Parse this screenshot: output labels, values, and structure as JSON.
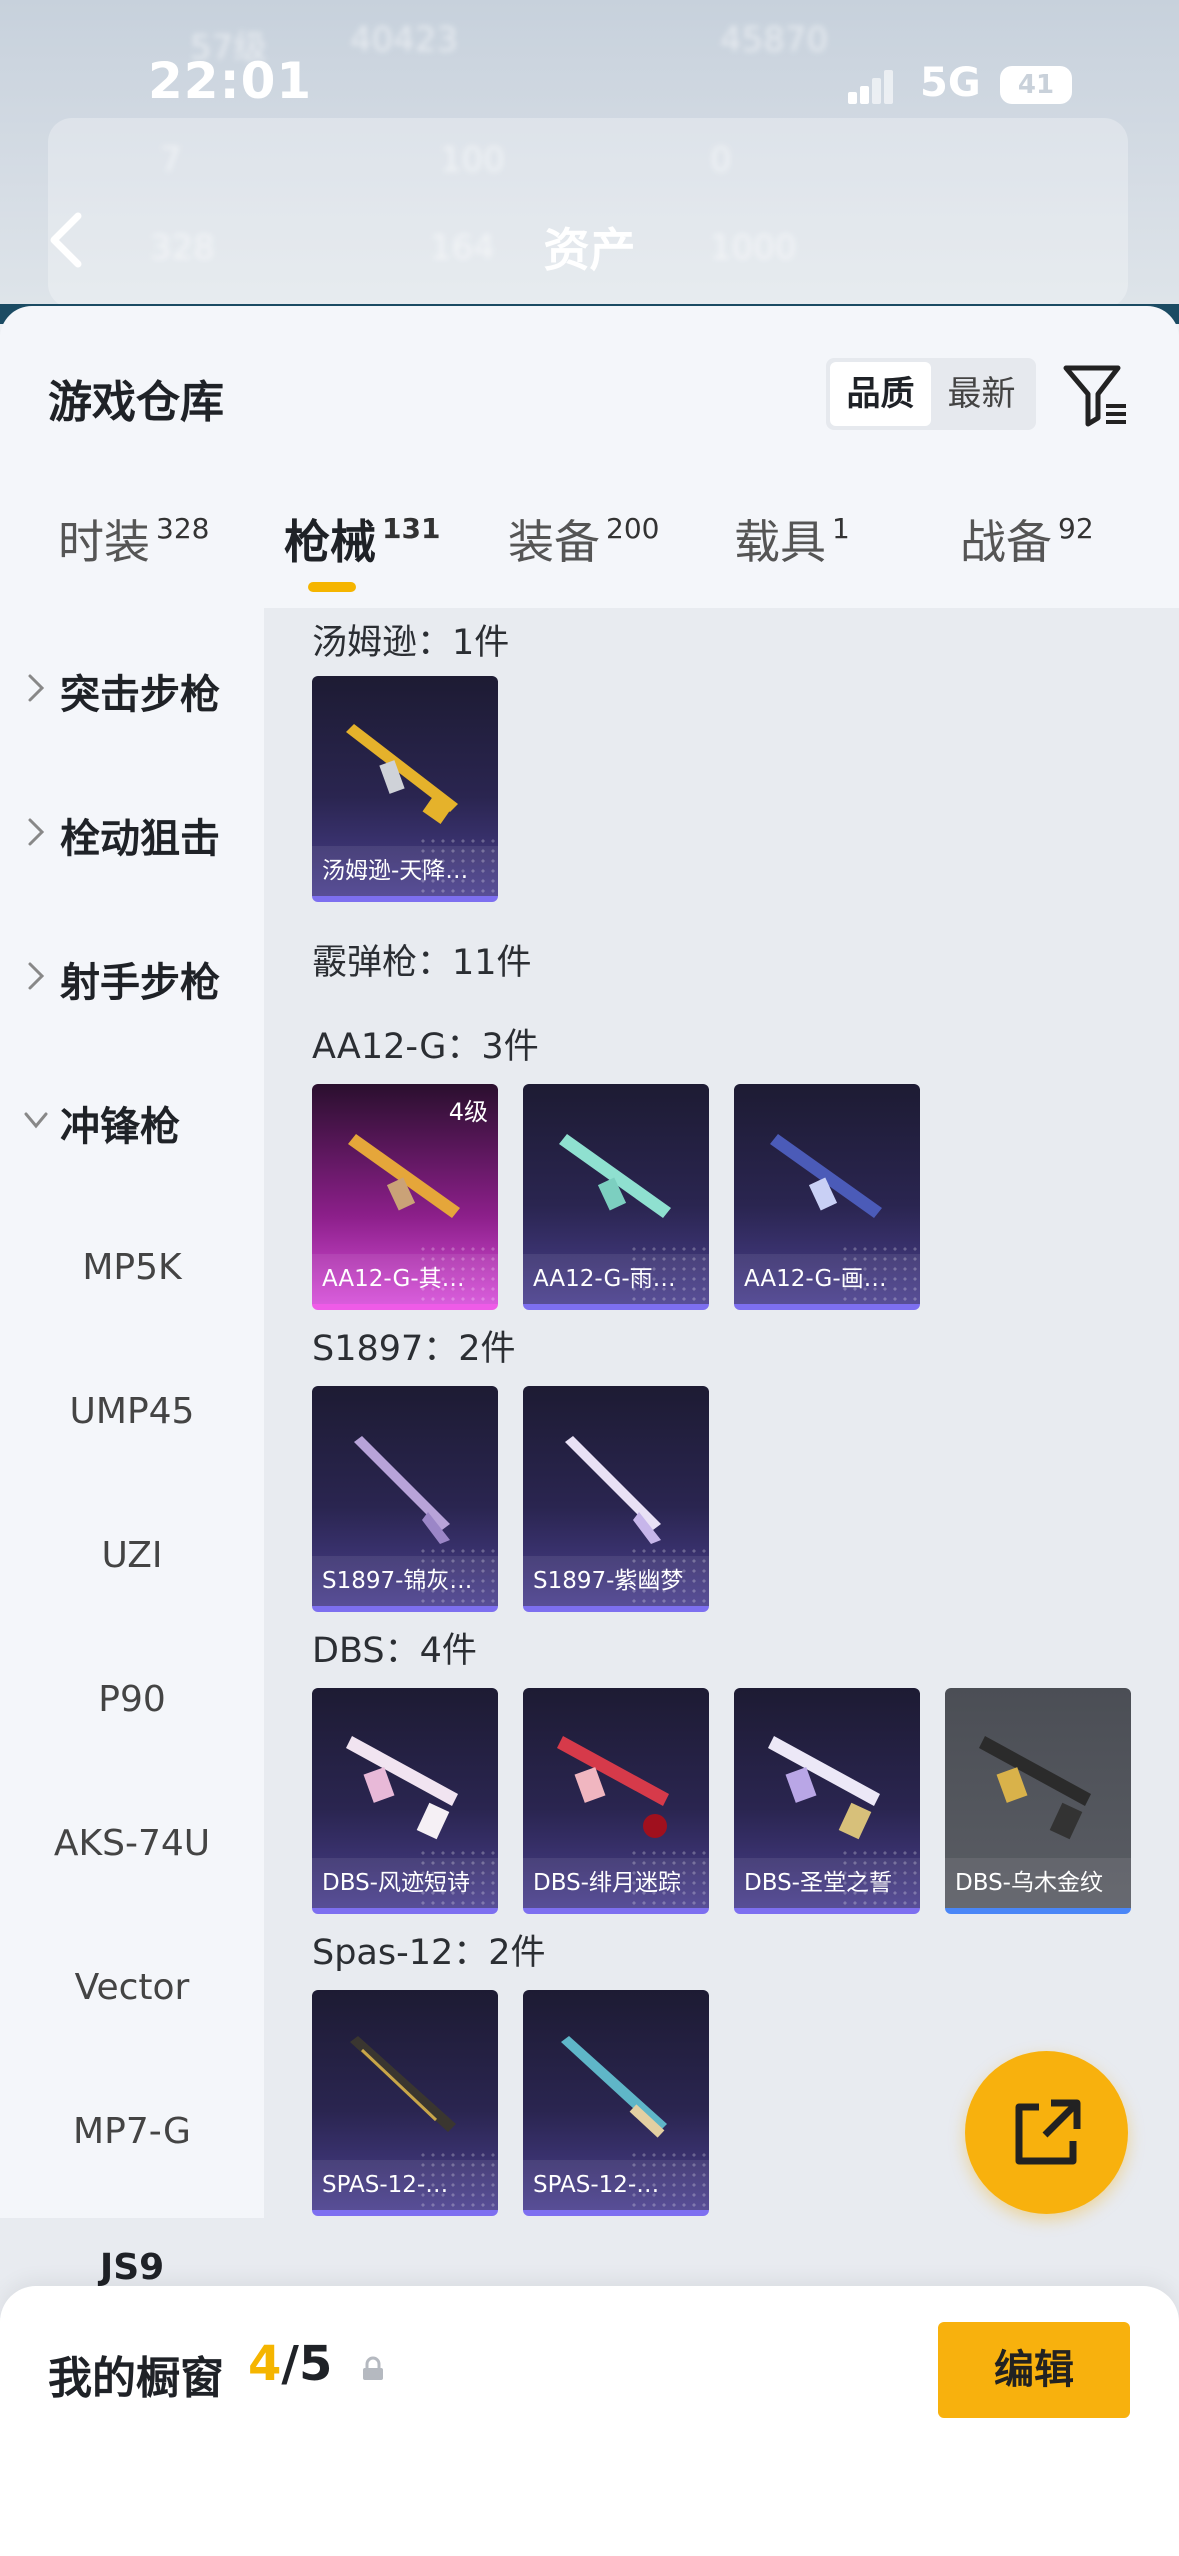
{
  "status_bar": {
    "time": "22:01",
    "network": "5G",
    "battery": "41"
  },
  "nav": {
    "title": "资产"
  },
  "background_header": {
    "ghost_texts": [
      "57级",
      "40423",
      "45870",
      "7",
      "100",
      "0",
      "328",
      "164",
      "1000"
    ]
  },
  "warehouse": {
    "title": "游戏仓库",
    "sort_options": [
      {
        "label": "品质",
        "active": true
      },
      {
        "label": "最新",
        "active": false
      }
    ],
    "tabs": [
      {
        "label": "时装",
        "count": "328"
      },
      {
        "label": "枪械",
        "count": "131",
        "active": true
      },
      {
        "label": "装备",
        "count": "200"
      },
      {
        "label": "载具",
        "count": "1"
      },
      {
        "label": "战备",
        "count": "92"
      }
    ]
  },
  "sidebar": {
    "categories": [
      "突击步枪",
      "栓动狙击",
      "射手步枪",
      "冲锋枪"
    ],
    "subitems": [
      "MP5K",
      "UMP45",
      "UZI",
      "P90",
      "AKS-74U",
      "Vector",
      "MP7-G",
      "JS9"
    ]
  },
  "content": {
    "groups": [
      {
        "header": "汤姆逊：1件",
        "items": [
          "汤姆逊-天降…"
        ]
      },
      {
        "header": "霰弹枪：11件",
        "items": []
      },
      {
        "header": "AA12-G：3件",
        "items": [
          "AA12-G-其…",
          "AA12-G-雨…",
          "AA12-G-画…"
        ]
      },
      {
        "header": "S1897：2件",
        "items": [
          "S1897-锦灰…",
          "S1897-紫幽梦"
        ]
      },
      {
        "header": "DBS：4件",
        "items": [
          "DBS-风迹短诗",
          "DBS-绯月迷踪",
          "DBS-圣堂之誓",
          "DBS-乌木金纹"
        ]
      },
      {
        "header": "Spas-12：2件",
        "items": [
          "SPAS-12-…",
          "SPAS-12-…"
        ]
      }
    ],
    "level_badge": "4级"
  },
  "bottom_panel": {
    "title": "我的橱窗",
    "count_current": "4",
    "count_total": "/5",
    "edit_label": "编辑"
  },
  "colors": {
    "accent": "#f5b500",
    "card_purple": "#2a2550",
    "card_pink": "#d64fd9",
    "card_grey": "#5a5d64"
  },
  "icons": [
    "back-arrow-icon",
    "filter-icon",
    "chevron-right-icon",
    "chevron-down-icon",
    "share-icon",
    "lock-icon"
  ]
}
